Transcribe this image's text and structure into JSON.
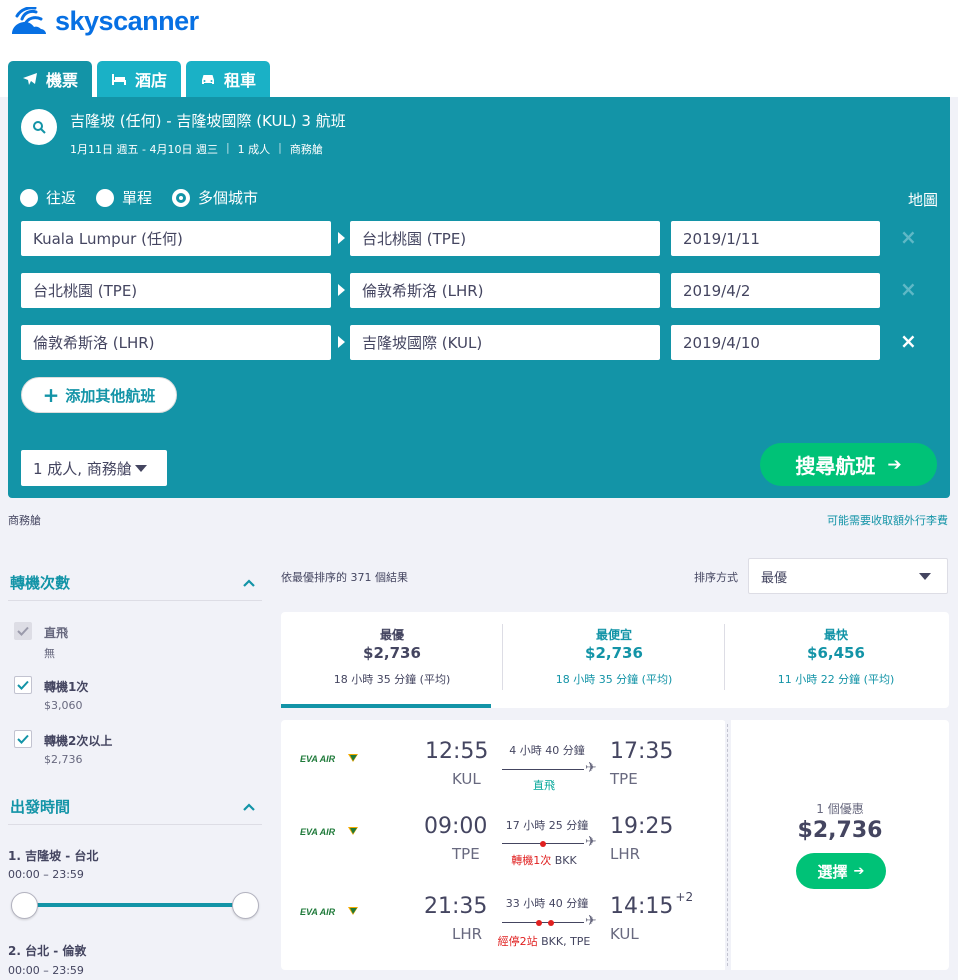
{
  "brand": {
    "name": "skyscanner",
    "color": "#0770e3"
  },
  "colors": {
    "teal": "#1394a7",
    "green": "#00c277",
    "red": "#e02020"
  },
  "tabs": [
    {
      "label": "機票",
      "icon": "plane-icon",
      "active": true
    },
    {
      "label": "酒店",
      "icon": "bed-icon",
      "active": false
    },
    {
      "label": "租車",
      "icon": "car-icon",
      "active": false
    }
  ],
  "summary": {
    "title": "吉隆坡 (任何) - 吉隆坡國際 (KUL) 3 航班",
    "dates": "1月11日 週五 - 4月10日 週三",
    "sep1": "|",
    "passengers": "1 成人",
    "sep2": "|",
    "cabin": "商務艙"
  },
  "trip_type": {
    "options": [
      "往返",
      "單程",
      "多個城市"
    ],
    "selected": "多個城市"
  },
  "map_link": "地圖",
  "legs": [
    {
      "from": "Kuala Lumpur (任何)",
      "to": "台北桃園 (TPE)",
      "date": "2019/1/11",
      "remove": "×"
    },
    {
      "from": "台北桃園 (TPE)",
      "to": "倫敦希斯洛 (LHR)",
      "date": "2019/4/2",
      "remove": "×"
    },
    {
      "from": "倫敦希斯洛 (LHR)",
      "to": "吉隆坡國際 (KUL)",
      "date": "2019/4/10",
      "remove": "×"
    }
  ],
  "add_flight": {
    "plus": "+",
    "label": "添加其他航班"
  },
  "pax_select": "1 成人, 商務艙",
  "search_button": {
    "label": "搜尋航班",
    "arrow": "➔"
  },
  "below_panel": {
    "cabin": "商務艙",
    "fees_note": "可能需要收取額外行李費"
  },
  "filters": {
    "stops": {
      "title": "轉機次數",
      "items": [
        {
          "label": "直飛",
          "sub": "無",
          "checked": true,
          "disabled": true
        },
        {
          "label": "轉機1次",
          "sub": "$3,060",
          "checked": true,
          "disabled": false
        },
        {
          "label": "轉機2次以上",
          "sub": "$2,736",
          "checked": true,
          "disabled": false
        }
      ]
    },
    "departure": {
      "title": "出發時間",
      "ranges": [
        {
          "label": "1. 吉隆坡 - 台北",
          "range": "00:00 – 23:59",
          "low": 0,
          "high": 1
        },
        {
          "label": "2. 台北 - 倫敦",
          "range": "00:00 – 23:59"
        }
      ]
    }
  },
  "results": {
    "count_text": "依最優排序的 371 個結果",
    "sort_label": "排序方式",
    "sort_value": "最優"
  },
  "sort_tabs": [
    {
      "title": "最優",
      "price": "$2,736",
      "duration": "18 小時 35 分鐘 (平均)",
      "active": true
    },
    {
      "title": "最便宜",
      "price": "$2,736",
      "duration": "18 小時 35 分鐘 (平均)",
      "active": false
    },
    {
      "title": "最快",
      "price": "$6,456",
      "duration": "11 小時 22 分鐘 (平均)",
      "active": false
    }
  ],
  "result_card": {
    "airline": "EVA AIR",
    "legs": [
      {
        "dep_time": "12:55",
        "dep_code": "KUL",
        "duration": "4 小時 40 分鐘",
        "stops_text": "直飛",
        "stops_extra": "",
        "stop_count": 0,
        "arr_time": "17:35",
        "arr_code": "TPE",
        "day_offset": ""
      },
      {
        "dep_time": "09:00",
        "dep_code": "TPE",
        "duration": "17 小時 25 分鐘",
        "stops_text": "轉機1次",
        "stops_extra": " BKK",
        "stop_count": 1,
        "arr_time": "19:25",
        "arr_code": "LHR",
        "day_offset": ""
      },
      {
        "dep_time": "21:35",
        "dep_code": "LHR",
        "duration": "33 小時 40 分鐘",
        "stops_text": "經停2站",
        "stops_extra": " BKK, TPE",
        "stop_count": 2,
        "arr_time": "14:15",
        "arr_code": "KUL",
        "day_offset": "+2"
      }
    ],
    "deals": "1 個優惠",
    "price": "$2,736",
    "select_label": "選擇",
    "select_arrow": "➔"
  }
}
